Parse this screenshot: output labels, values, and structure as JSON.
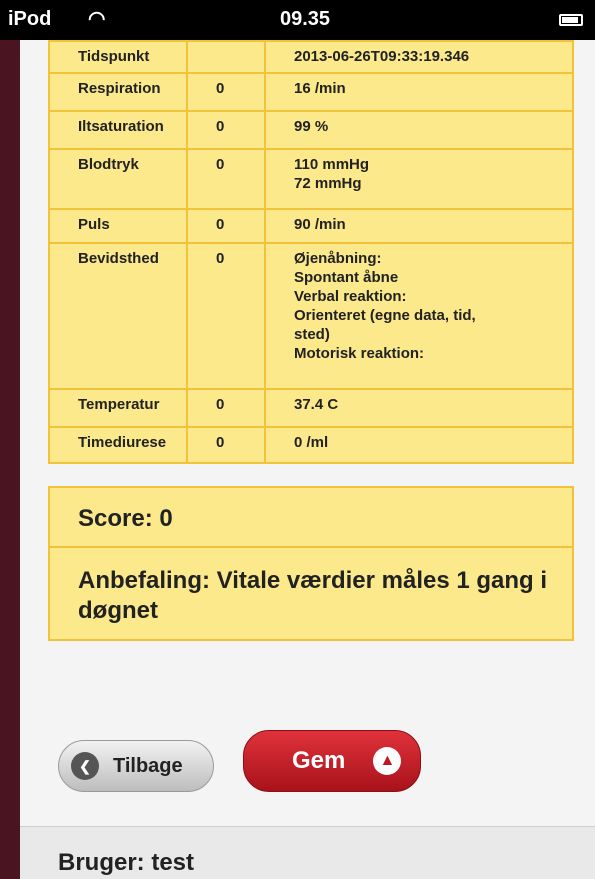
{
  "statusbar": {
    "carrier": "iPod",
    "wifi_icon": "wifi-icon",
    "time": "09.35"
  },
  "table": {
    "rows": [
      {
        "label": "Tidspunkt",
        "score": "",
        "value": "2013-06-26T09:33:19.346"
      },
      {
        "label": "Respiration",
        "score": "0",
        "value": "16 /min"
      },
      {
        "label": "Iltsaturation",
        "score": "0",
        "value": "99 %"
      },
      {
        "label": "Blodtryk",
        "score": "0",
        "value": "110 mmHg\n72 mmHg"
      },
      {
        "label": "Puls",
        "score": "0",
        "value": "90 /min"
      },
      {
        "label": "Bevidsthed",
        "score": "0",
        "value": "Øjenåbning:\nSpontant åbne\nVerbal reaktion:\nOrienteret (egne data, tid,\nsted)\nMotorisk reaktion:"
      },
      {
        "label": "Temperatur",
        "score": "0",
        "value": "37.4 C"
      },
      {
        "label": "Timediurese",
        "score": "0",
        "value": "0 /ml"
      }
    ]
  },
  "score": "Score: 0",
  "recommendation": "Anbefaling: Vitale værdier måles 1 gang i døgnet",
  "buttons": {
    "back_label": "Tilbage",
    "save_label": "Gem"
  },
  "footer": {
    "user_text": "Bruger: test"
  },
  "colors": {
    "panel_bg": "#fbe98c",
    "panel_border": "#f2c23a",
    "save_button": "#c41c24"
  }
}
